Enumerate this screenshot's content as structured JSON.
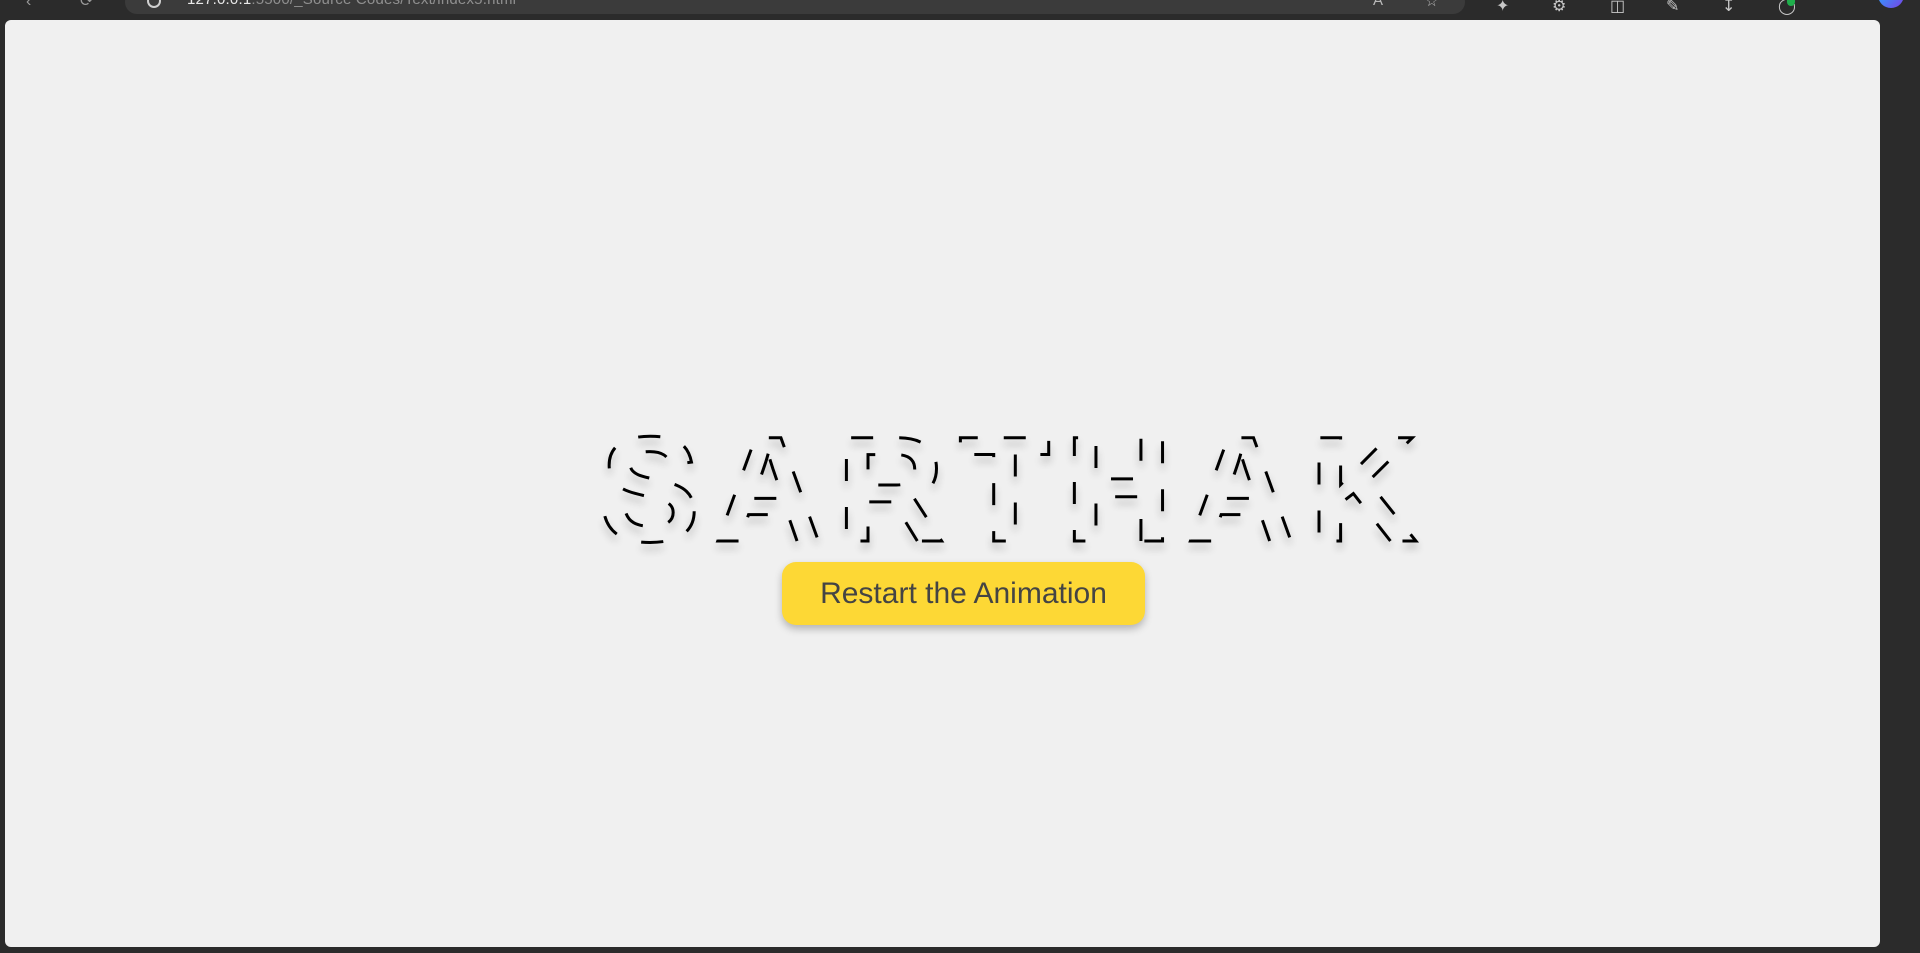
{
  "browser": {
    "url_host": "127.0.0.1",
    "url_rest": ":5500/_Source Codes/Text/index5.html",
    "icons": [
      "back-icon",
      "refresh-icon",
      "site-info-icon",
      "read-aloud-icon",
      "favorite-icon",
      "extensions-icon",
      "settings-icon",
      "split-screen-icon",
      "collections-icon",
      "downloads-icon",
      "copilot-icon",
      "profile-icon"
    ]
  },
  "page": {
    "headline": "SARTHAK",
    "button_label": "Restart the Animation"
  },
  "colors": {
    "page_bg": "#f0f0f0",
    "button_bg": "#fdd835",
    "button_text": "#444444",
    "stroke": "#000000",
    "chrome_bg": "#2b2b2b"
  }
}
